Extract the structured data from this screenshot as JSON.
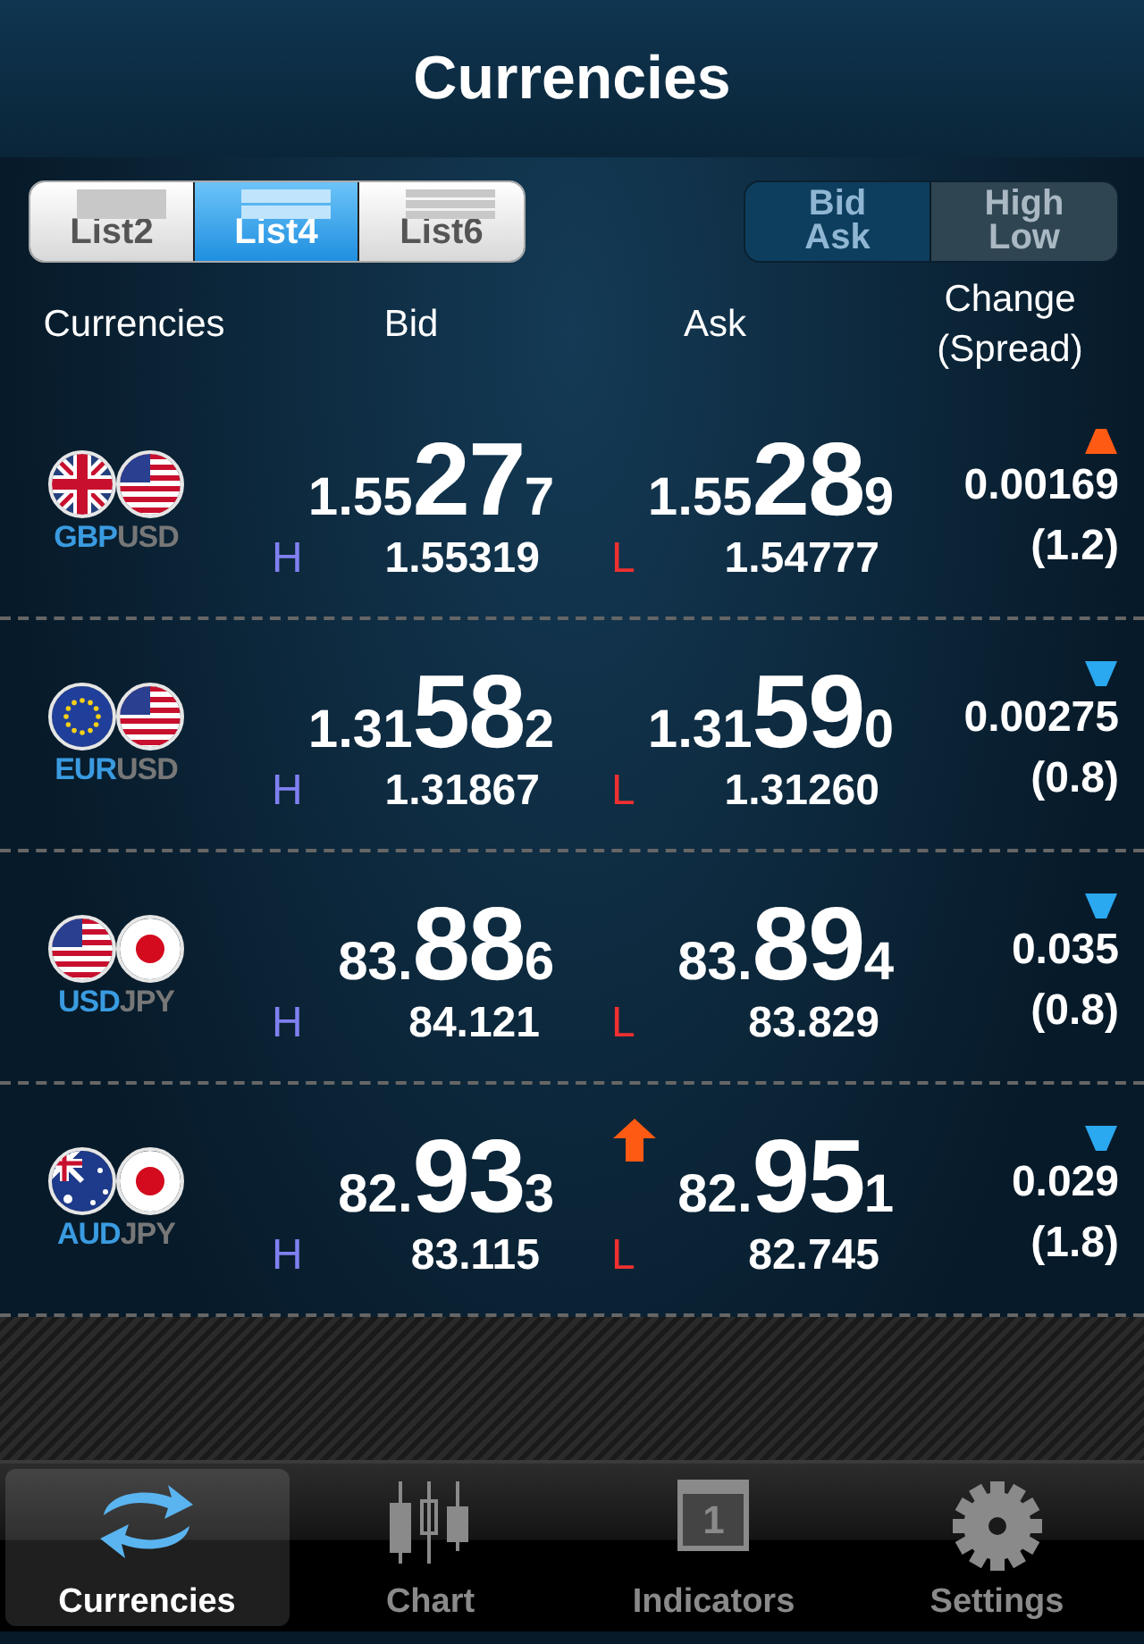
{
  "header": {
    "title": "Currencies"
  },
  "list_tabs": [
    {
      "label": "List2",
      "selected": false
    },
    {
      "label": "List4",
      "selected": true
    },
    {
      "label": "List6",
      "selected": false
    }
  ],
  "mode_tabs": [
    {
      "lines": [
        "Bid",
        "Ask"
      ],
      "selected": true
    },
    {
      "lines": [
        "High",
        "Low"
      ],
      "selected": false
    }
  ],
  "columns": [
    "Currencies",
    "Bid",
    "Ask",
    [
      "Change",
      "(Spread)"
    ]
  ],
  "rows": [
    {
      "pair": [
        {
          "code": "GBP",
          "kind": "gb"
        },
        {
          "code": "USD",
          "kind": "us"
        }
      ],
      "bid": [
        "1.55",
        "27",
        "7"
      ],
      "high_label": "H",
      "high": "1.55319",
      "ask": [
        "1.55",
        "28",
        "9"
      ],
      "low_label": "L",
      "low": "1.54777",
      "ask_up_flash": false,
      "rising": true,
      "change": "0.00169",
      "spread": "(1.2)"
    },
    {
      "pair": [
        {
          "code": "EUR",
          "kind": "eu"
        },
        {
          "code": "USD",
          "kind": "us"
        }
      ],
      "bid": [
        "1.31",
        "58",
        "2"
      ],
      "high_label": "H",
      "high": "1.31867",
      "ask": [
        "1.31",
        "59",
        "0"
      ],
      "low_label": "L",
      "low": "1.31260",
      "ask_up_flash": false,
      "rising": false,
      "change": "0.00275",
      "spread": "(0.8)"
    },
    {
      "pair": [
        {
          "code": "USD",
          "kind": "us"
        },
        {
          "code": "JPY",
          "kind": "jp"
        }
      ],
      "bid": [
        "83.",
        "88",
        "6"
      ],
      "high_label": "H",
      "high": "84.121",
      "ask": [
        "83.",
        "89",
        "4"
      ],
      "low_label": "L",
      "low": "83.829",
      "ask_up_flash": false,
      "rising": false,
      "change": "0.035",
      "spread": "(0.8)"
    },
    {
      "pair": [
        {
          "code": "AUD",
          "kind": "au"
        },
        {
          "code": "JPY",
          "kind": "jp"
        }
      ],
      "bid": [
        "82.",
        "93",
        "3"
      ],
      "high_label": "H",
      "high": "83.115",
      "ask": [
        "82.",
        "95",
        "1"
      ],
      "low_label": "L",
      "low": "82.745",
      "ask_up_flash": true,
      "rising": false,
      "change": "0.029",
      "spread": "(1.8)"
    }
  ],
  "tab_bar": [
    {
      "label": "Currencies",
      "kind": "exchange",
      "selected": true
    },
    {
      "label": "Chart",
      "kind": "candles",
      "selected": false
    },
    {
      "label": "Indicators",
      "kind": "calendar",
      "icon_text": "1",
      "selected": false
    },
    {
      "label": "Settings",
      "kind": "gear",
      "selected": false
    }
  ]
}
